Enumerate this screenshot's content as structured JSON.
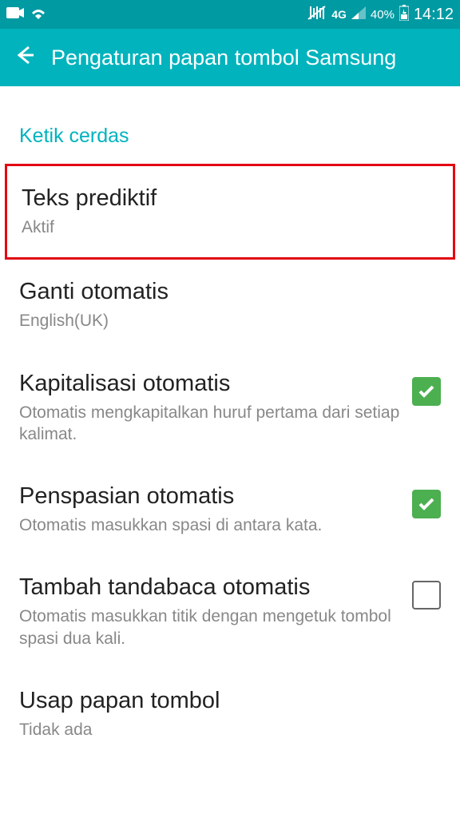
{
  "statusBar": {
    "networkLabel": "4G",
    "battery": "40%",
    "time": "14:12"
  },
  "appBar": {
    "title": "Pengaturan papan tombol Samsung"
  },
  "sectionHeader": "Ketik cerdas",
  "settings": [
    {
      "title": "Teks prediktif",
      "subtitle": "Aktif"
    },
    {
      "title": "Ganti otomatis",
      "subtitle": "English(UK)"
    },
    {
      "title": "Kapitalisasi otomatis",
      "subtitle": "Otomatis mengkapitalkan huruf pertama dari setiap kalimat."
    },
    {
      "title": "Penspasian otomatis",
      "subtitle": "Otomatis masukkan spasi di antara kata."
    },
    {
      "title": "Tambah tandabaca otomatis",
      "subtitle": "Otomatis masukkan titik dengan mengetuk tombol spasi dua kali."
    },
    {
      "title": "Usap papan tombol",
      "subtitle": "Tidak ada"
    }
  ]
}
